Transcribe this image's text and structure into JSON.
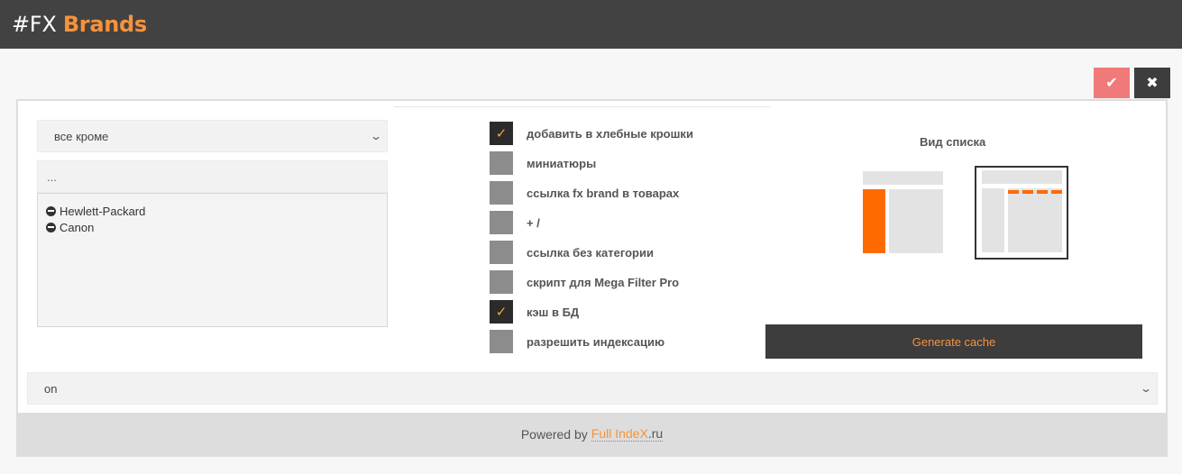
{
  "header": {
    "title_prefix": "#FX",
    "title_accent": "Brands"
  },
  "toolbar": {
    "save_glyph": "✔",
    "close_glyph": "✖"
  },
  "filter": {
    "mode_value": "все кроме",
    "search_placeholder": "...",
    "brands": [
      {
        "name": "Hewlett-Packard"
      },
      {
        "name": "Canon"
      }
    ]
  },
  "options": [
    {
      "label": "добавить в хлебные крошки",
      "checked": true
    },
    {
      "label": "миниатюры",
      "checked": false
    },
    {
      "label": "ссылка fx brand в товарах",
      "checked": false
    },
    {
      "label": "+ /",
      "checked": false
    },
    {
      "label": "ссылка без категории",
      "checked": false
    },
    {
      "label": "скрипт для Mega Filter Pro",
      "checked": false
    },
    {
      "label": "кэш в БД",
      "checked": true
    },
    {
      "label": "разрешить индексацию",
      "checked": false
    }
  ],
  "check_glyph": "✓",
  "view": {
    "title": "Вид списка",
    "selected": "top-bar"
  },
  "generate_label": "Generate cache",
  "status_select_value": "on",
  "footer": {
    "prefix": "Powered by",
    "link_main": "Full IndeX",
    "link_tld": ".ru"
  },
  "colors": {
    "accent": "#f7923a",
    "header_bg": "#424242",
    "save_bg": "#f07a7a",
    "view_orange": "#ff6a00"
  }
}
